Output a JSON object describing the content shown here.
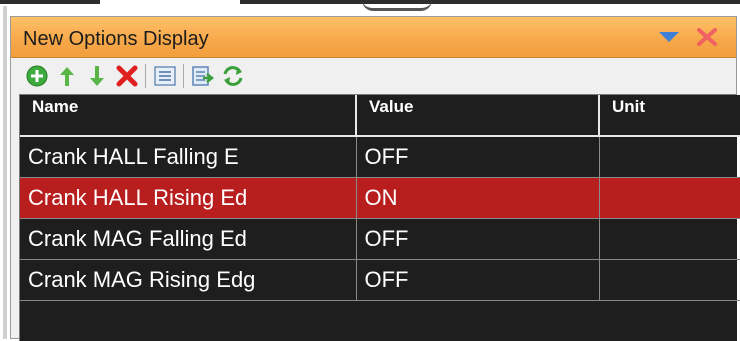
{
  "panel": {
    "title": "New Options Display"
  },
  "toolbar": {
    "icons": [
      "add-icon",
      "move-up-icon",
      "move-down-icon",
      "delete-icon",
      "list-icon",
      "export-icon",
      "refresh-icon"
    ]
  },
  "table": {
    "columns": [
      "Name",
      "Value",
      "Unit"
    ],
    "rows": [
      {
        "name": "Crank HALL Falling E",
        "value": "OFF",
        "unit": ""
      },
      {
        "name": "Crank HALL Rising Ed",
        "value": "ON",
        "unit": ""
      },
      {
        "name": "Crank MAG Falling Ed",
        "value": "OFF",
        "unit": ""
      },
      {
        "name": "Crank MAG Rising Edg",
        "value": "OFF",
        "unit": ""
      }
    ],
    "selected_row": 1
  },
  "colors": {
    "titlebar": "#f7a94b",
    "selection": "#b81e1e",
    "grid_background": "#1e1e1e"
  }
}
